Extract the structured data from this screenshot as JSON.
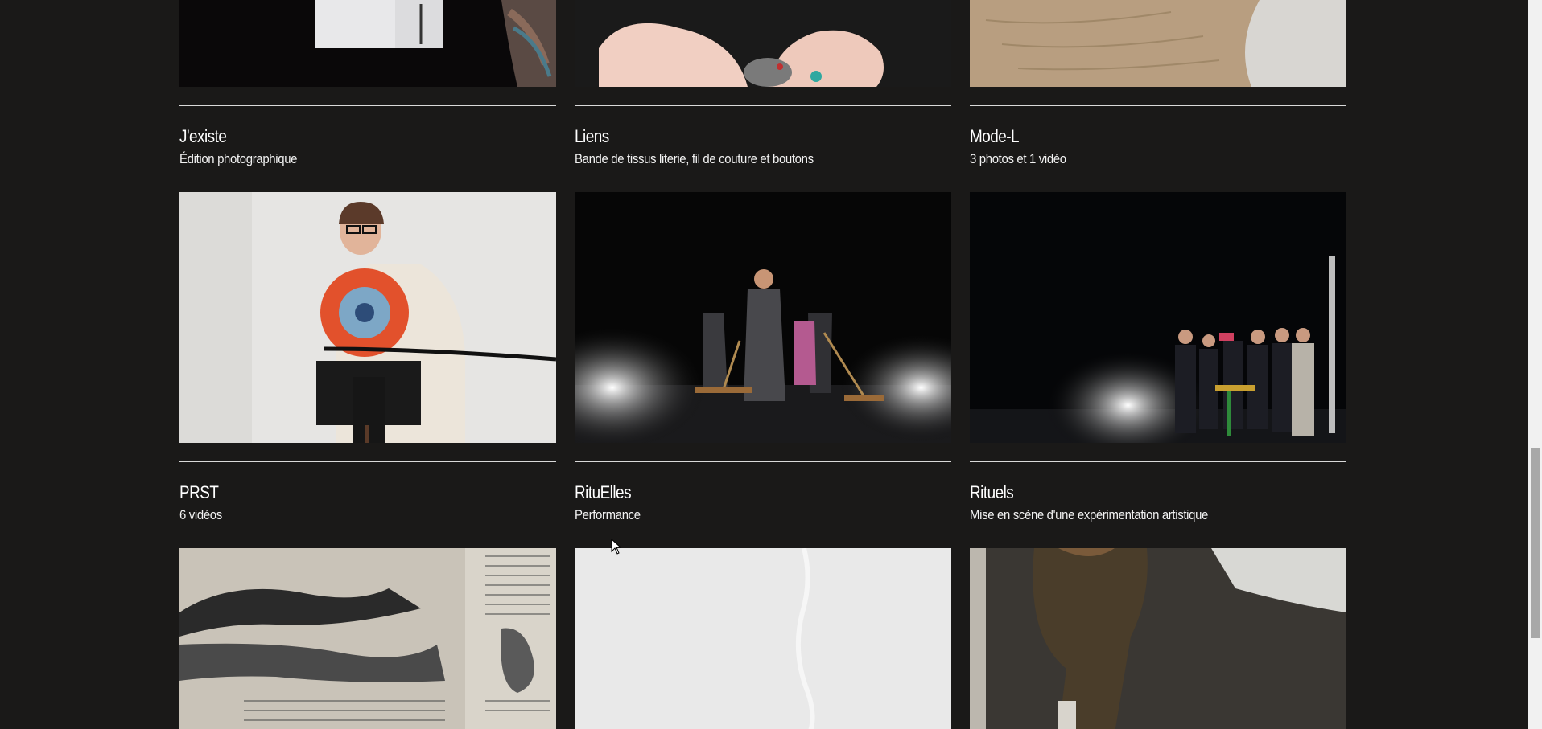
{
  "projects": [
    {
      "title": "J'existe",
      "subtitle": "Édition photographique"
    },
    {
      "title": "Liens",
      "subtitle": "Bande de tissus literie, fil de couture et boutons"
    },
    {
      "title": "Mode-L",
      "subtitle": "3 photos et 1 vidéo"
    },
    {
      "title": "PRST",
      "subtitle": "6 vidéos"
    },
    {
      "title": "RituElles",
      "subtitle": "Performance"
    },
    {
      "title": "Rituels",
      "subtitle": "Mise en scène d'une expérimentation artistique"
    }
  ],
  "colors": {
    "background": "#1a1918",
    "text": "#ffffff",
    "rule": "#d9d9d9"
  }
}
